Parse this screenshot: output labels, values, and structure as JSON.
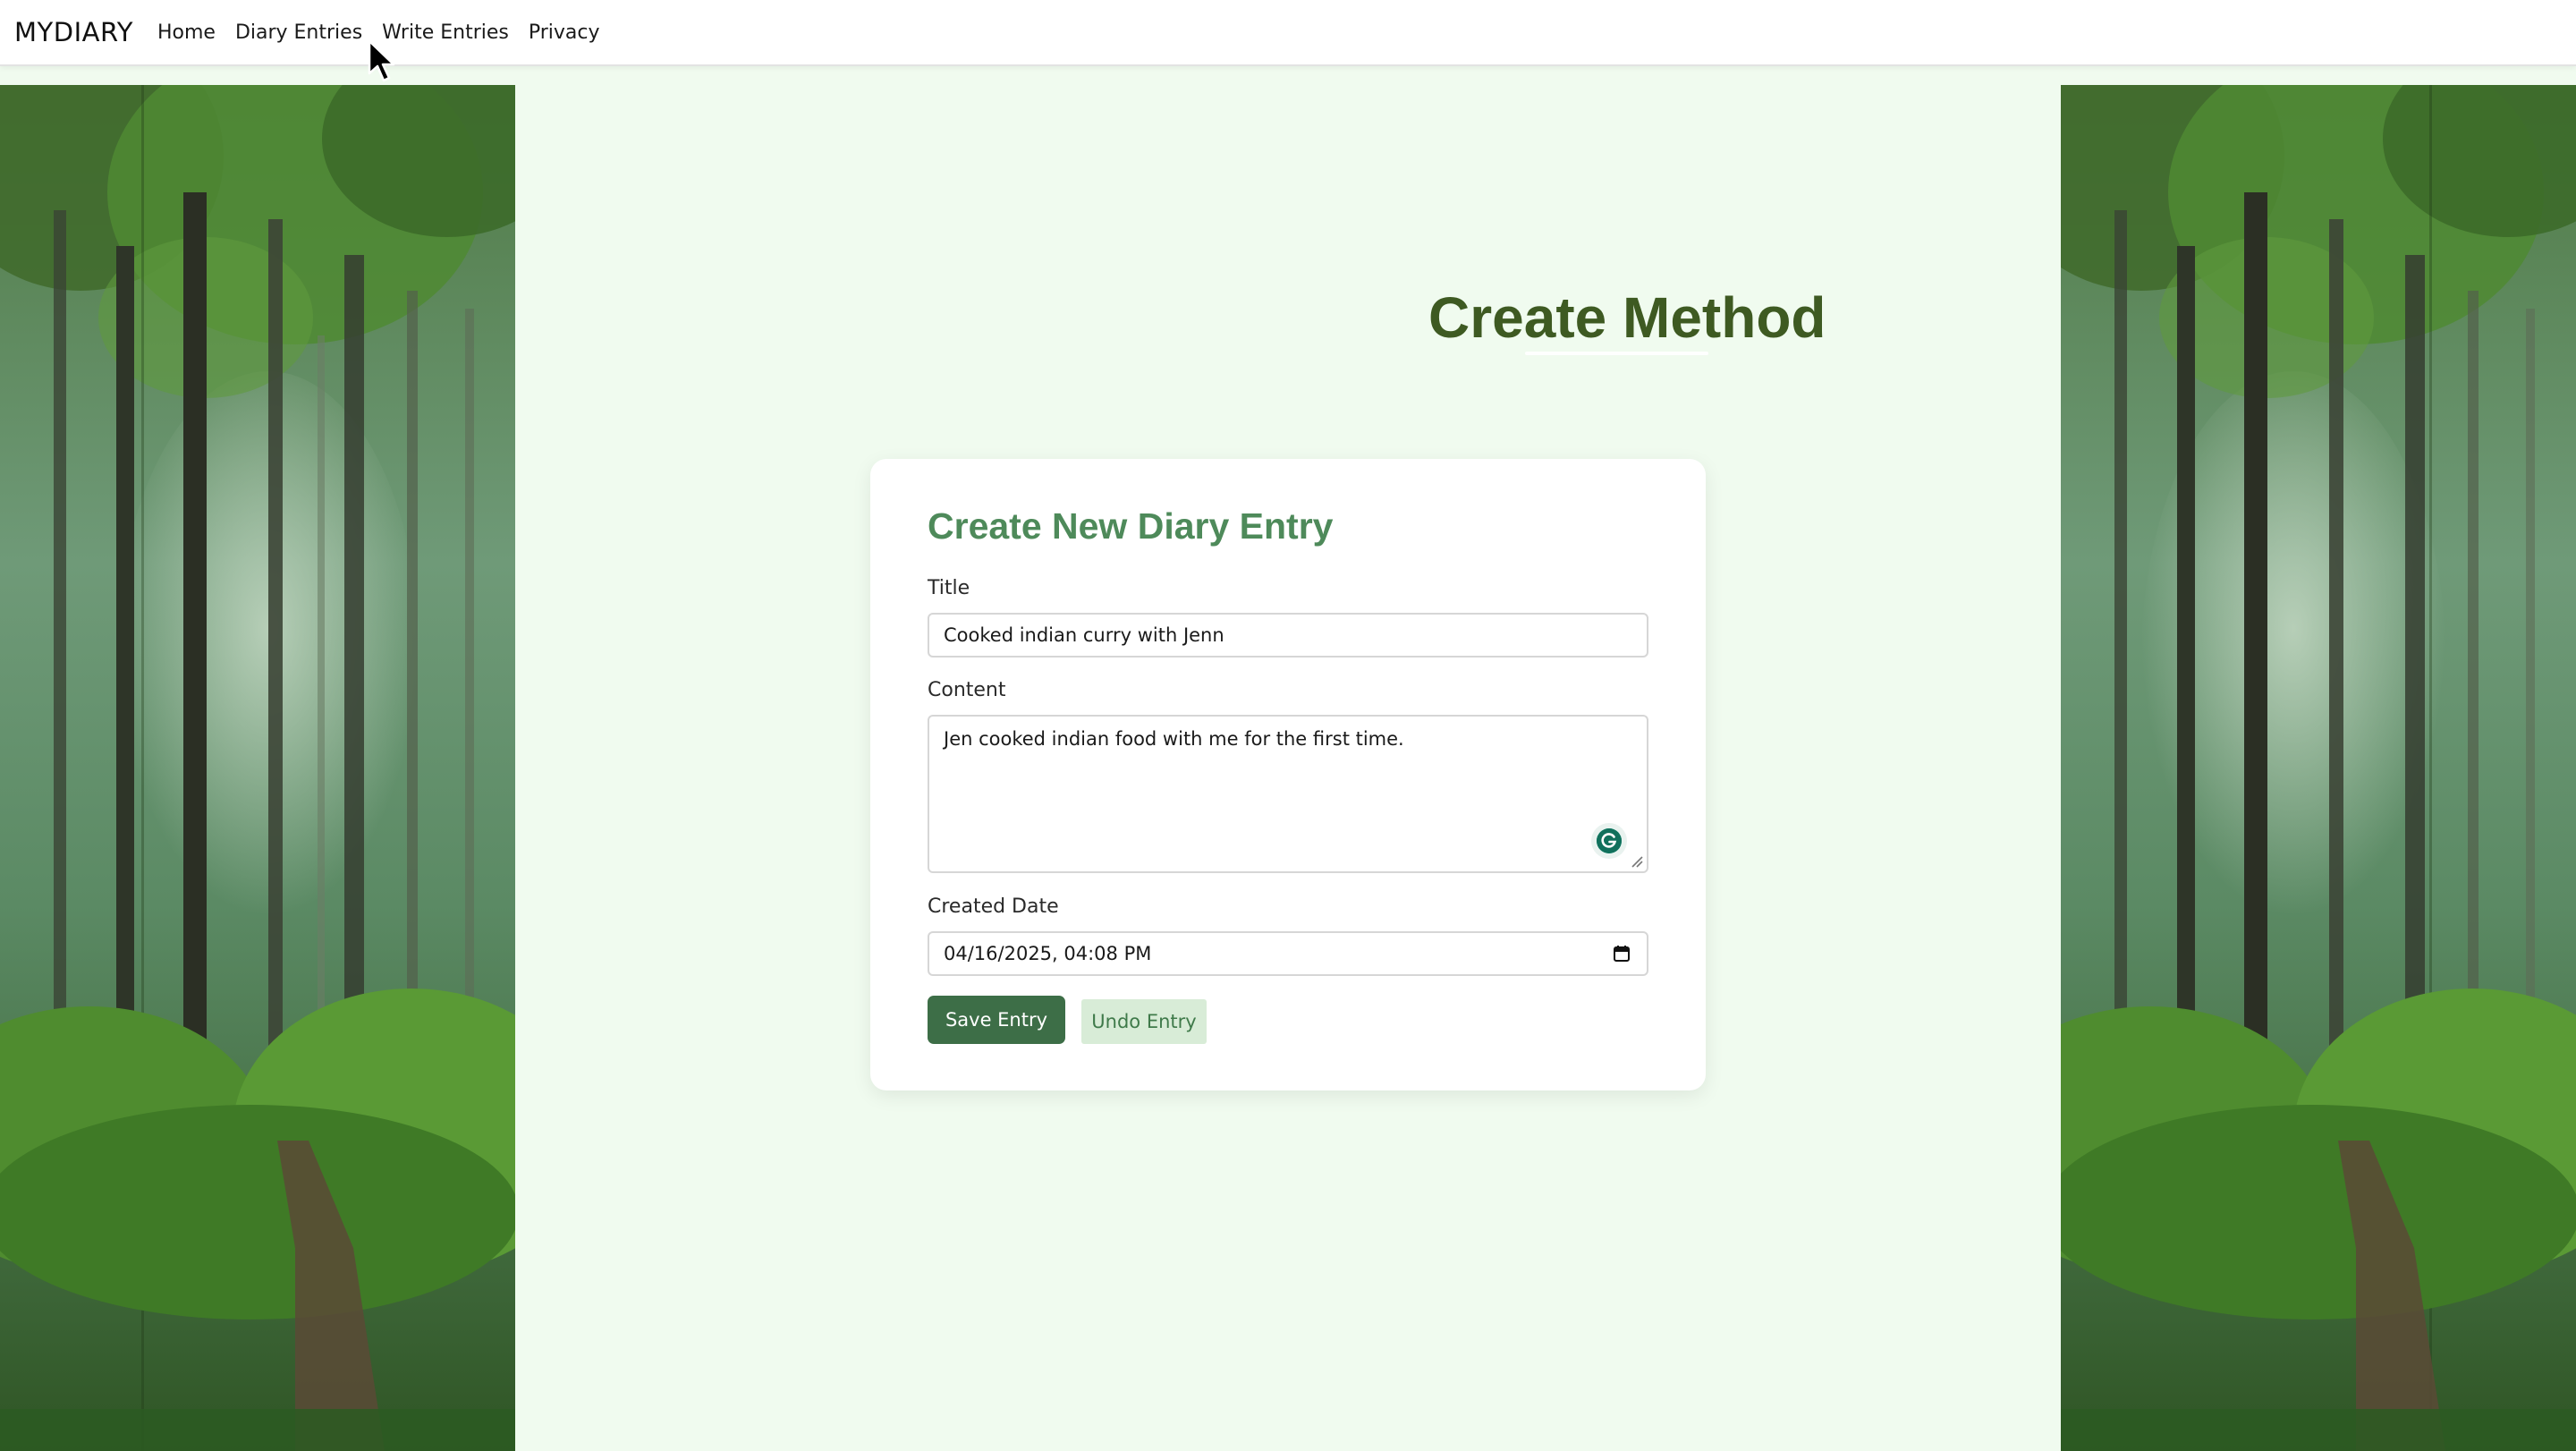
{
  "navbar": {
    "brand": "MYDIARY",
    "links": [
      {
        "label": "Home"
      },
      {
        "label": "Diary Entries"
      },
      {
        "label": "Write Entries"
      },
      {
        "label": "Privacy"
      }
    ]
  },
  "page": {
    "heading": "Create Method"
  },
  "form": {
    "title": "Create New Diary Entry",
    "title_label": "Title",
    "title_value": "Cooked indian curry with Jenn",
    "content_label": "Content",
    "content_value": "Jen cooked indian food with me for the first time.",
    "date_label": "Created Date",
    "date_value": "04/16/2025, 04:08 PM",
    "save_label": "Save Entry",
    "undo_label": "Undo Entry"
  },
  "colors": {
    "accent": "#3d6e47",
    "heading": "#3e5a22",
    "card_title": "#4e8a5a",
    "background": "#f0fbef"
  },
  "icons": {
    "calendar": "calendar-icon",
    "grammarly": "grammarly-icon",
    "cursor": "mouse-cursor-icon"
  }
}
